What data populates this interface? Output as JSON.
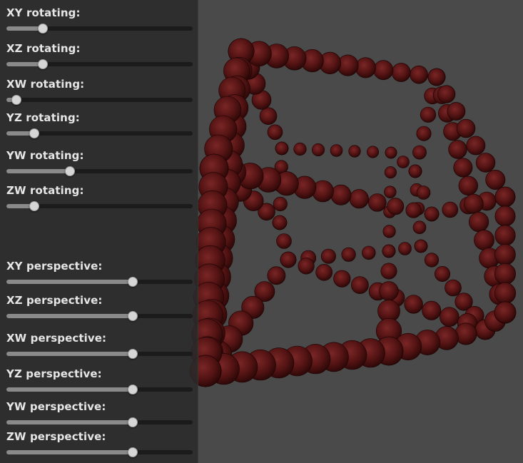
{
  "controls": {
    "rotating": [
      {
        "label": "XY rotating:",
        "value": 0.18
      },
      {
        "label": "XZ rotating:",
        "value": 0.18
      },
      {
        "label": "XW rotating:",
        "value": 0.03
      },
      {
        "label": "YZ rotating:",
        "value": 0.13
      },
      {
        "label": "YW rotating:",
        "value": 0.33
      },
      {
        "label": "ZW rotating:",
        "value": 0.13
      }
    ],
    "perspective": [
      {
        "label": "XY perspective:",
        "value": 0.69
      },
      {
        "label": "XZ perspective:",
        "value": 0.69
      },
      {
        "label": "XW perspective:",
        "value": 0.69
      },
      {
        "label": "YZ perspective:",
        "value": 0.69
      },
      {
        "label": "YW perspective:",
        "value": 0.69
      },
      {
        "label": "ZW perspective:",
        "value": 0.69
      }
    ]
  },
  "scene": {
    "background_color": "#4a4a4a",
    "sphere_color": "#5a1414",
    "sphere_highlight_color": "#7a2020",
    "object": "tesseract-wireframe-of-spheres"
  }
}
